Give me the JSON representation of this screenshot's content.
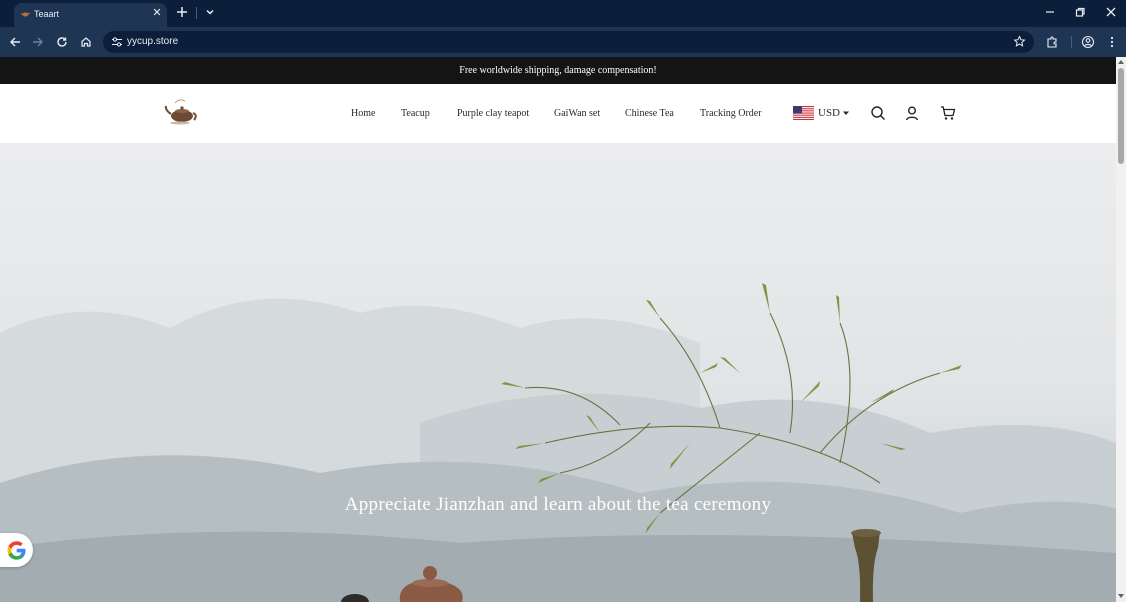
{
  "browser": {
    "tab_title": "Teaart",
    "url": "yycup.store",
    "favicon": "teapot-favicon-icon"
  },
  "announcement": {
    "text": "Free worldwide shipping, damage compensation!"
  },
  "header": {
    "logo": "teapot-logo-icon",
    "nav": [
      {
        "label": "Home"
      },
      {
        "label": "Teacup"
      },
      {
        "label": "Purple clay teapot"
      },
      {
        "label": "GaiWan set"
      },
      {
        "label": "Chinese Tea"
      },
      {
        "label": "Tracking Order"
      }
    ],
    "currency": "USD",
    "currency_flag": "us-flag-icon",
    "icons": [
      "search-icon",
      "account-icon",
      "cart-icon"
    ]
  },
  "hero": {
    "headline": "Appreciate Jianzhan and learn about the tea ceremony"
  },
  "colors": {
    "announcement_bg": "#141414",
    "browser_frame": "#0b1f3a",
    "browser_toolbar": "#1f3554",
    "hero_sky": "#e9ebec"
  }
}
